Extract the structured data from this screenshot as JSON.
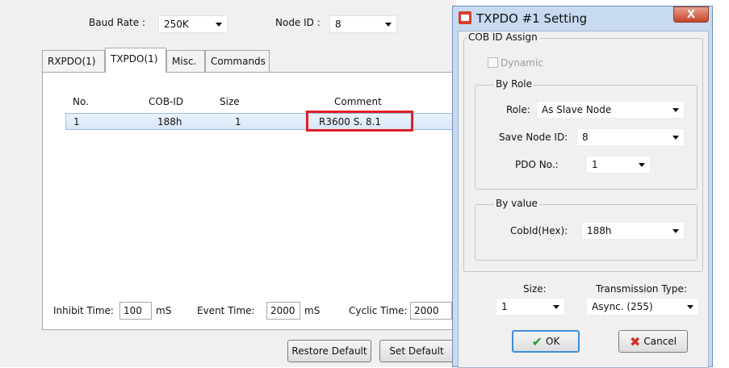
{
  "main": {
    "baud_rate_label": "Baud Rate :",
    "baud_rate_value": "250K",
    "node_id_label": "Node ID :",
    "node_id_value": "8",
    "tabs": [
      "RXPDO(1)",
      "TXPDO(1)",
      "Misc.",
      "Commands"
    ],
    "table": {
      "headers": [
        "No.",
        "COB-ID",
        "Size",
        "Comment"
      ],
      "rows": [
        {
          "no": "1",
          "cob_id": "188h",
          "size": "1",
          "comment": "R3600 S. 8.1"
        }
      ]
    },
    "inhibit_label": "Inhibit Time:",
    "inhibit_value": "100",
    "inhibit_unit": "mS",
    "event_label": "Event Time:",
    "event_value": "2000",
    "event_unit": "mS",
    "cyclic_label": "Cyclic Time:",
    "cyclic_value": "2000",
    "restore_default": "Restore Default",
    "set_default": "Set Default"
  },
  "dialog": {
    "title": "TXPDO #1 Setting",
    "close_label": "X",
    "cob_group": "COB ID Assign",
    "dynamic_label": "Dynamic",
    "by_role_label": "By Role",
    "role_label": "Role:",
    "role_value": "As Slave Node",
    "slave_node_id_label": "Save Node ID:",
    "slave_node_id_value": "8",
    "pdo_no_label": "PDO No.:",
    "pdo_no_value": "1",
    "by_value_label": "By value",
    "cobid_label": "CobId(Hex):",
    "cobid_value": "188h",
    "size_label": "Size:",
    "size_value": "1",
    "transmission_label": "Transmission Type:",
    "transmission_value": "Async. (255)",
    "ok_label": "OK",
    "cancel_label": "Cancel"
  },
  "colors": {
    "highlight_box": "#e11e27",
    "selected_row": "#d9e7f7",
    "dialog_frame": "#c7daf0",
    "ok_check": "#2e9a2e",
    "cancel_x": "#d22f27"
  }
}
